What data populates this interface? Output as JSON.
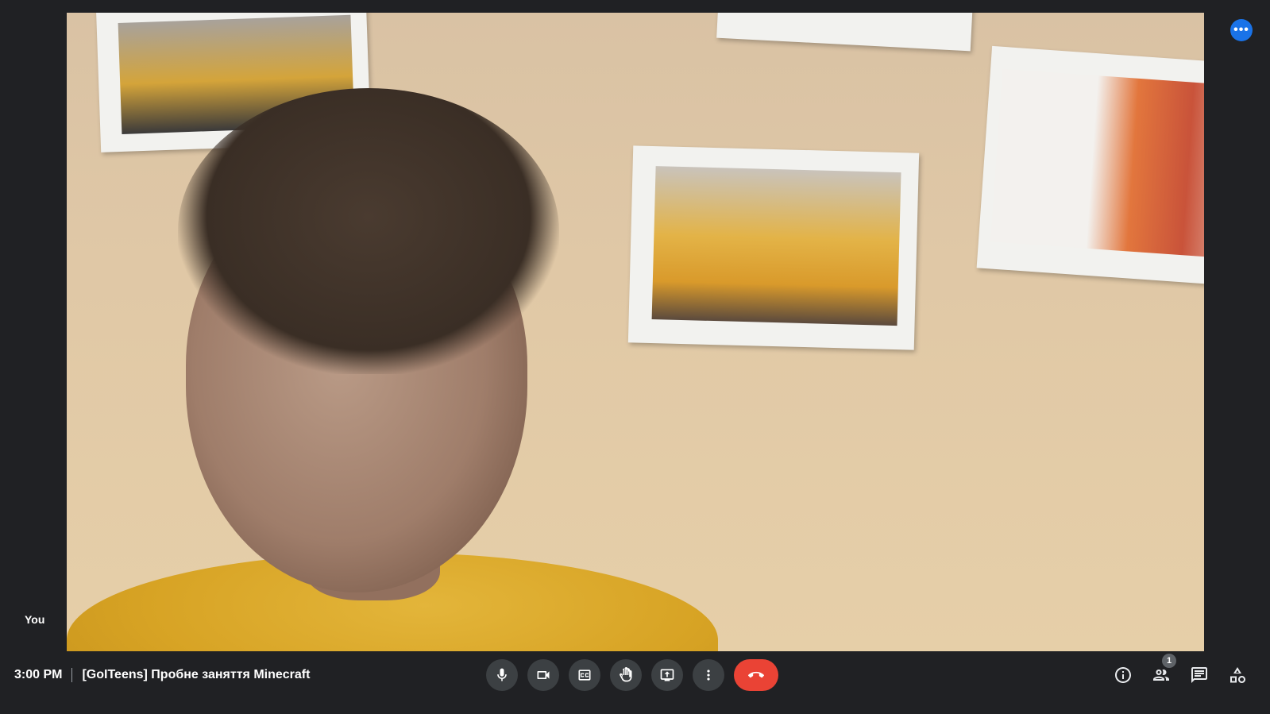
{
  "video": {
    "self_label": "You",
    "more_options_icon": "more-horiz-icon"
  },
  "meeting": {
    "time": "3:00 PM",
    "title": "[GoITeens] Пробне заняття Minecraft"
  },
  "controls": [
    {
      "name": "microphone-button",
      "icon": "mic-icon"
    },
    {
      "name": "camera-button",
      "icon": "videocam-icon"
    },
    {
      "name": "captions-button",
      "icon": "closed-caption-icon"
    },
    {
      "name": "raise-hand-button",
      "icon": "hand-icon"
    },
    {
      "name": "present-now-button",
      "icon": "present-screen-icon"
    },
    {
      "name": "more-options-button",
      "icon": "more-vert-icon"
    },
    {
      "name": "leave-call-button",
      "icon": "call-end-icon",
      "color": "#ea4335"
    }
  ],
  "side_actions": {
    "people_count": "1",
    "icons": [
      "info-icon",
      "people-icon",
      "chat-icon",
      "activities-icon"
    ]
  },
  "colors": {
    "background": "#202124",
    "button": "#3c4043",
    "end_call": "#ea4335",
    "accent": "#1a73e8"
  }
}
